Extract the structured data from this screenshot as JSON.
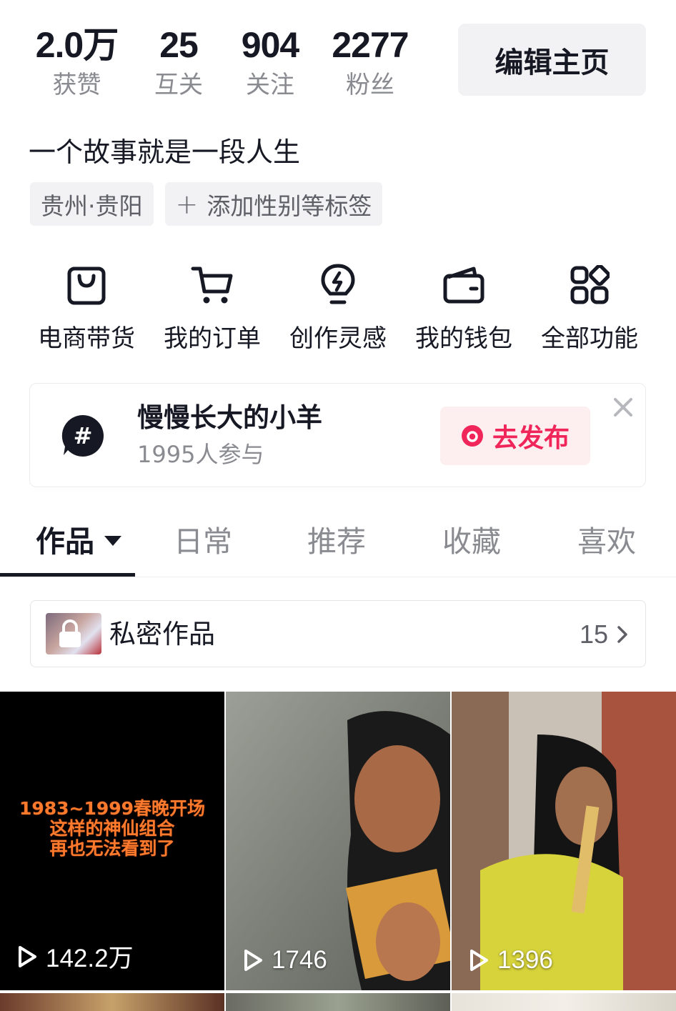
{
  "stats": {
    "likes": {
      "value": "2.0万",
      "label": "获赞"
    },
    "mutual": {
      "value": "25",
      "label": "互关"
    },
    "following": {
      "value": "904",
      "label": "关注"
    },
    "fans": {
      "value": "2277",
      "label": "粉丝"
    }
  },
  "edit_button": "编辑主页",
  "bio": "一个故事就是一段人生",
  "tags": {
    "location": "贵州·贵阳",
    "add_tag": "添加性别等标签"
  },
  "functions": [
    {
      "label": "电商带货",
      "icon": "shopping-bag-icon"
    },
    {
      "label": "我的订单",
      "icon": "cart-icon"
    },
    {
      "label": "创作灵感",
      "icon": "lightbulb-icon"
    },
    {
      "label": "我的钱包",
      "icon": "wallet-icon"
    },
    {
      "label": "全部功能",
      "icon": "grid-apps-icon"
    }
  ],
  "topic": {
    "icon": "hashtag-icon",
    "title": "慢慢长大的小羊",
    "participants": "1995人参与",
    "publish_label": "去发布"
  },
  "tabs": [
    {
      "label": "作品",
      "active": true
    },
    {
      "label": "日常",
      "active": false
    },
    {
      "label": "推荐",
      "active": false
    },
    {
      "label": "收藏",
      "active": false
    },
    {
      "label": "喜欢",
      "active": false
    }
  ],
  "private_works": {
    "label": "私密作品",
    "count": "15"
  },
  "videos": [
    {
      "views": "142.2万",
      "caption": "1983~1999春晚开场\n这样的神仙组合\n再也无法看到了"
    },
    {
      "views": "1746"
    },
    {
      "views": "1396"
    }
  ],
  "colors": {
    "accent": "#f0265a",
    "text_primary": "#161823",
    "text_secondary": "#8a8b91",
    "chip_bg": "#f2f2f4"
  }
}
